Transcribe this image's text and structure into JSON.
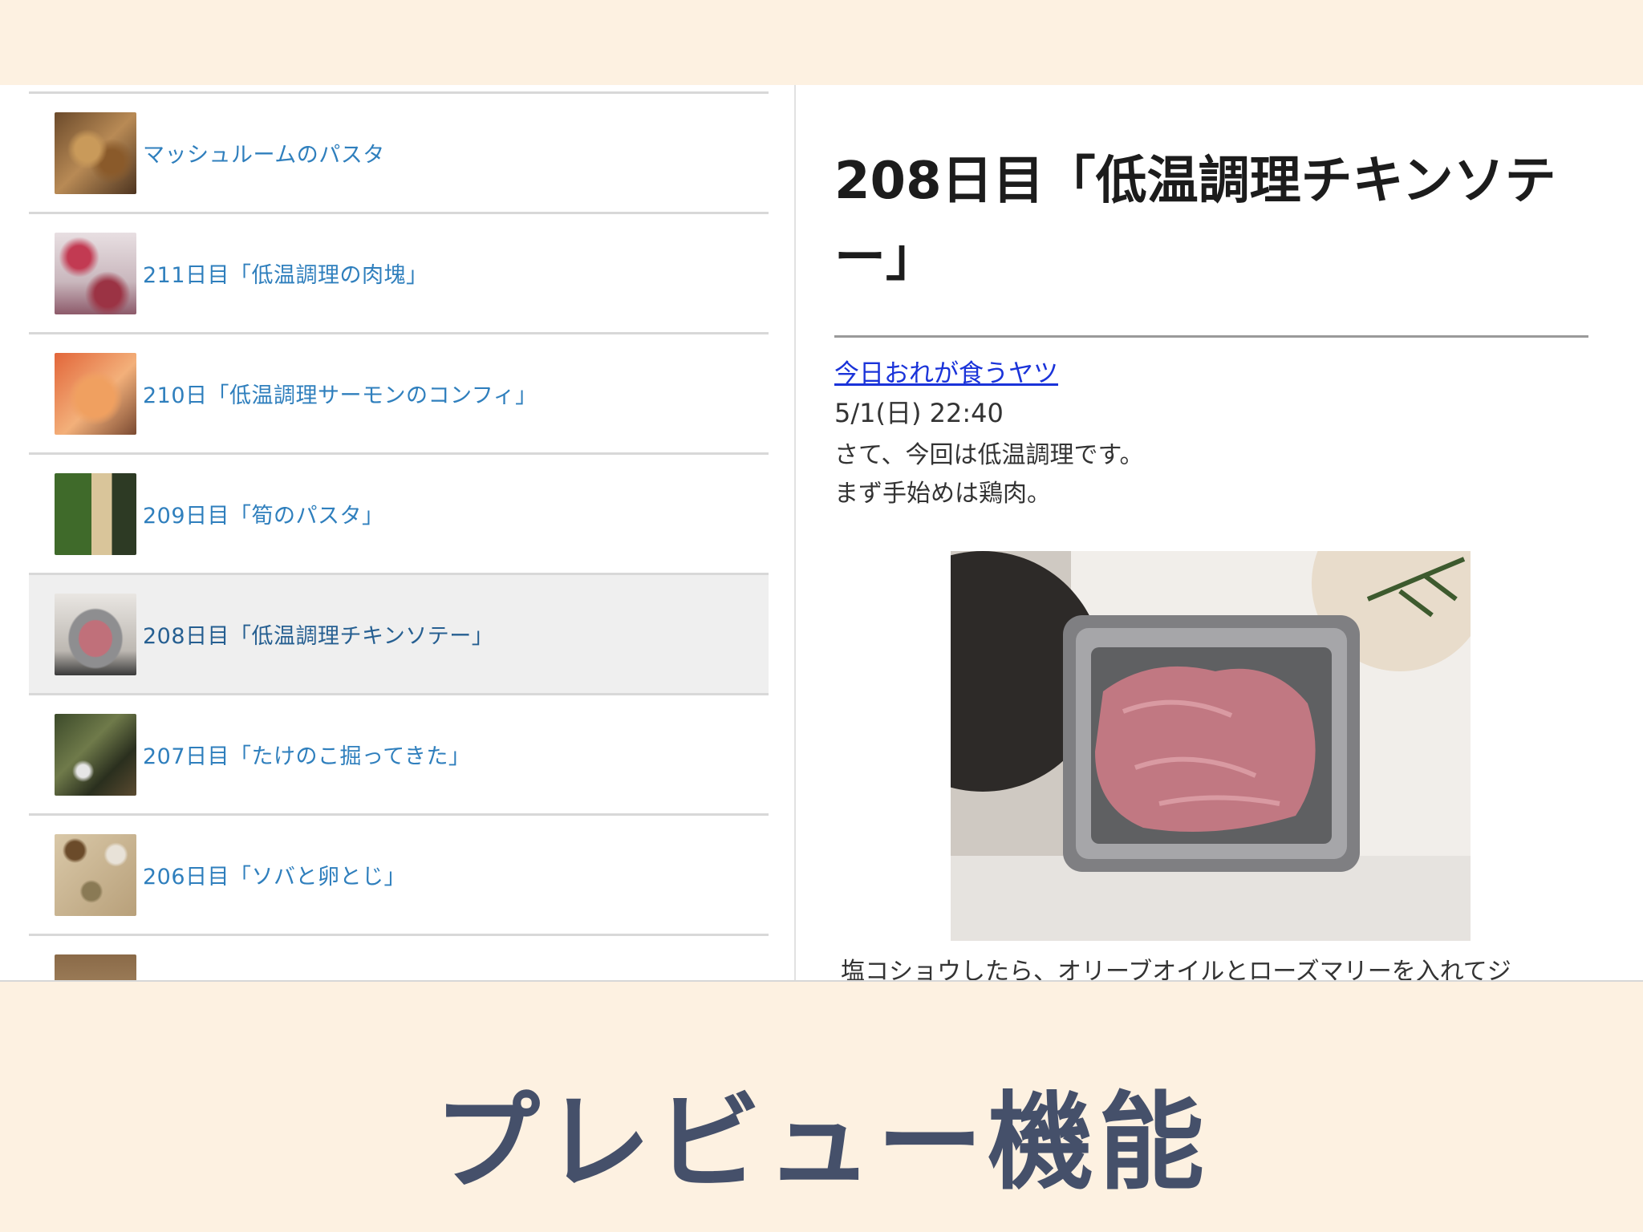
{
  "list": {
    "items": [
      {
        "label": "マッシュルームのパスタ",
        "selected": false
      },
      {
        "label": "211日目「低温調理の肉塊」",
        "selected": false
      },
      {
        "label": "210日「低温調理サーモンのコンフィ」",
        "selected": false
      },
      {
        "label": "209日目「筍のパスタ」",
        "selected": false
      },
      {
        "label": "208日目「低温調理チキンソテー」",
        "selected": true
      },
      {
        "label": "207日目「たけのこ掘ってきた」",
        "selected": false
      },
      {
        "label": "206日目「ソバと卵とじ」",
        "selected": false
      }
    ]
  },
  "detail": {
    "title_line1": "208日目「低温調理チキンソテ",
    "title_line2": "ー」",
    "category": "今日おれが食うヤツ",
    "date": "5/1(日) 22:40",
    "body_line1": "さて、今回は低温調理です。",
    "body_line2": "まず手始めは鶏肉。",
    "cut_text": "塩コショウしたら、オリーブオイルとローズマリーを入れてジ"
  },
  "caption": "プレビュー機能",
  "colors": {
    "background": "#fdf1e1",
    "list_link": "#2f7fbd",
    "category_link": "#1a33d9",
    "caption": "#45506a",
    "selected_row": "#efefef"
  }
}
